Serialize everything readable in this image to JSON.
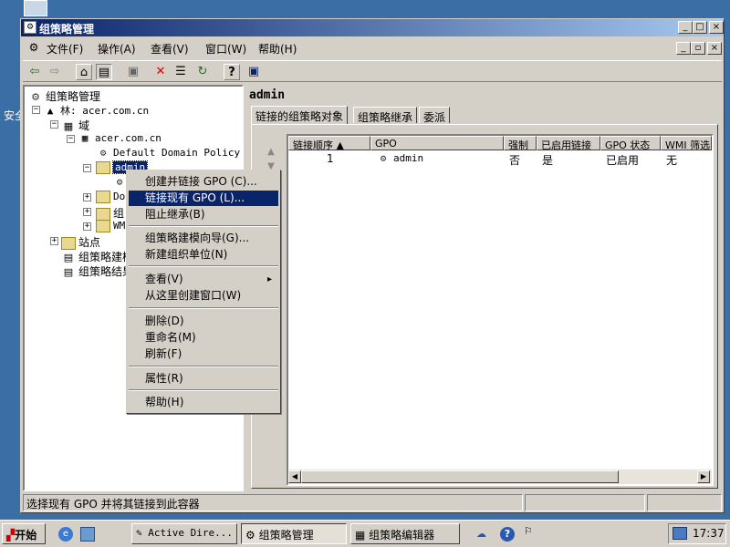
{
  "desktop": {
    "partial_text": "安全"
  },
  "window": {
    "title": "组策略管理",
    "controls": {
      "minimize": "_",
      "maximize": "□",
      "close": "×"
    }
  },
  "menubar": {
    "items": [
      "文件(F)",
      "操作(A)",
      "查看(V)",
      "窗口(W)",
      "帮助(H)"
    ],
    "mdi_controls": {
      "minimize": "_",
      "restore": "▫",
      "close": "×"
    }
  },
  "toolbar": {
    "back": "⇦",
    "forward": "⇨",
    "up": "⌂",
    "tree": "▤",
    "copy": "▣",
    "delete": "✕",
    "properties": "☰",
    "refresh": "↻",
    "help": "?",
    "console": "▣"
  },
  "tree": {
    "root": "组策略管理",
    "forest": "林: acer.com.cn",
    "domains": "域",
    "domain": "acer.com.cn",
    "default_policy": "Default Domain Policy",
    "admin_ou": "admin",
    "child_do": "Do",
    "child_zu": "组",
    "child_wm": "WM",
    "sites": "站点",
    "modeling": "组策略建模",
    "results": "组策略结果"
  },
  "right": {
    "title": "admin",
    "tabs": [
      "链接的组策略对象",
      "组策略继承",
      "委派"
    ],
    "columns": [
      "链接顺序 ▲",
      "GPO",
      "强制",
      "已启用链接",
      "GPO 状态",
      "WMI 筛选"
    ],
    "rows": [
      {
        "order": "1",
        "gpo": "admin",
        "enforced": "否",
        "link_enabled": "是",
        "status": "已启用",
        "wmi": "无"
      }
    ]
  },
  "context_menu": {
    "items": [
      "创建并链接 GPO (C)...",
      "链接现有 GPO (L)...",
      "阻止继承(B)",
      "组策略建模向导(G)...",
      "新建组织单位(N)",
      "查看(V)",
      "从这里创建窗口(W)",
      "删除(D)",
      "重命名(M)",
      "刷新(F)",
      "属性(R)",
      "帮助(H)"
    ],
    "submenu_arrow": "▸"
  },
  "statusbar": {
    "text": "选择现有 GPO 并将其链接到此容器"
  },
  "taskbar": {
    "start": "开始",
    "tasks": [
      "Active Dire...",
      "组策略管理",
      "组策略编辑器"
    ],
    "clock": "17:37"
  },
  "colors": {
    "titlebar": "#0a246a",
    "selection": "#0a246a",
    "desktop": "#3a6ea5",
    "face": "#d4d0c8"
  }
}
